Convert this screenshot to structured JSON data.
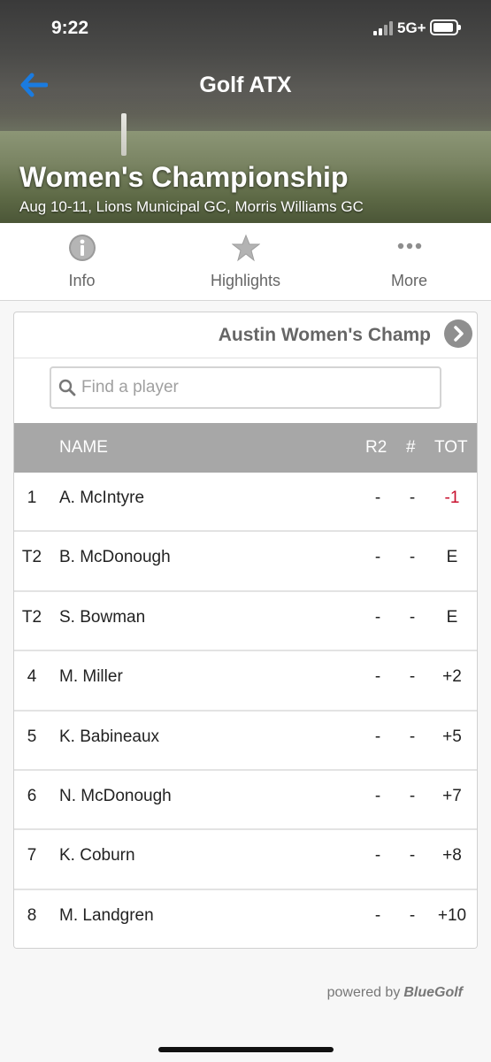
{
  "status": {
    "time": "9:22",
    "network": "5G+",
    "battery_level": 0.9
  },
  "header": {
    "app_title": "Golf ATX",
    "event_title": "Women's Championship",
    "event_subtitle": "Aug 10-11, Lions Municipal GC, Morris Williams GC"
  },
  "tabs": [
    {
      "label": "Info",
      "icon": "info-icon"
    },
    {
      "label": "Highlights",
      "icon": "star-icon"
    },
    {
      "label": "More",
      "icon": "more-icon"
    }
  ],
  "leaderboard": {
    "title": "Austin Women's Champ",
    "search_placeholder": "Find a player",
    "columns": {
      "name": "NAME",
      "r2": "R2",
      "hash": "#",
      "tot": "TOT"
    },
    "rows": [
      {
        "pos": "1",
        "name": "A. McIntyre",
        "r2": "-",
        "hash": "-",
        "tot": "-1"
      },
      {
        "pos": "T2",
        "name": "B. McDonough",
        "r2": "-",
        "hash": "-",
        "tot": "E"
      },
      {
        "pos": "T2",
        "name": "S. Bowman",
        "r2": "-",
        "hash": "-",
        "tot": "E"
      },
      {
        "pos": "4",
        "name": "M. Miller",
        "r2": "-",
        "hash": "-",
        "tot": "+2"
      },
      {
        "pos": "5",
        "name": "K. Babineaux",
        "r2": "-",
        "hash": "-",
        "tot": "+5"
      },
      {
        "pos": "6",
        "name": "N. McDonough",
        "r2": "-",
        "hash": "-",
        "tot": "+7"
      },
      {
        "pos": "7",
        "name": "K. Coburn",
        "r2": "-",
        "hash": "-",
        "tot": "+8"
      },
      {
        "pos": "8",
        "name": "M. Landgren",
        "r2": "-",
        "hash": "-",
        "tot": "+10"
      }
    ]
  },
  "footer": {
    "powered_by": "powered by",
    "brand": "BlueGolf"
  },
  "colors": {
    "accent": "#1a7be0",
    "under_par": "#c8102e",
    "table_header": "#a7a7a7"
  }
}
